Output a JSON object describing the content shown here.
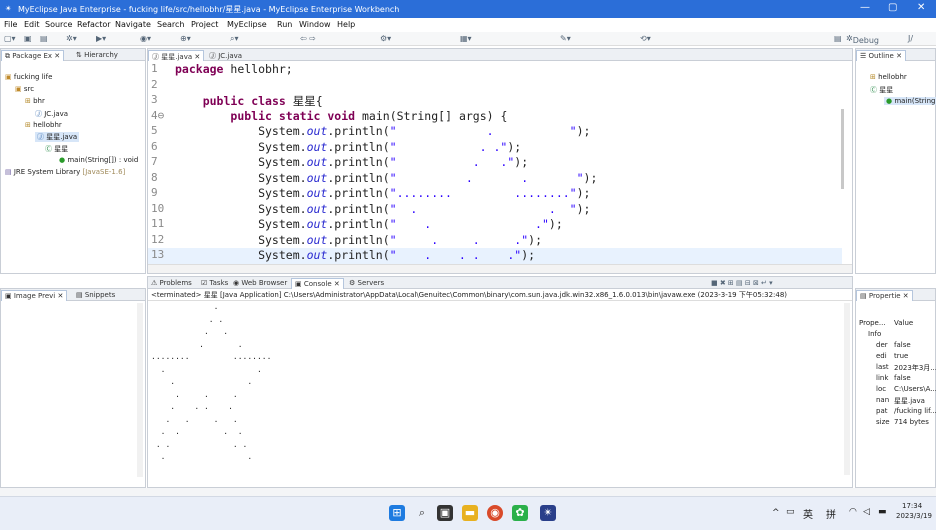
{
  "window": {
    "title": "MyEclipse Java Enterprise - fucking life/src/hellobhr/星星.java - MyEclipse Enterprise Workbench",
    "minimize": "—",
    "maximize": "▢",
    "close": "✕"
  },
  "menu": [
    "File",
    "Edit",
    "Source",
    "Refactor",
    "Navigate",
    "Search",
    "Project",
    "MyEclipse",
    "Run",
    "Window",
    "Help"
  ],
  "perspectives": {
    "debug": "Debug",
    "other": "J/"
  },
  "package_explorer": {
    "tabs": [
      "Package Ex",
      "Hierarchy"
    ],
    "tree": [
      {
        "label": "fucking life"
      },
      {
        "label": "src"
      },
      {
        "label": "bhr"
      },
      {
        "label": "JC.java"
      },
      {
        "label": "hellobhr"
      },
      {
        "label": "星星.java"
      },
      {
        "label": "星星"
      },
      {
        "label": "main(String[]) : void"
      },
      {
        "label": "JRE System Library",
        "suffix": "[JavaSE-1.6]"
      }
    ]
  },
  "image_panel": {
    "tabs": [
      "Image Previ",
      "Snippets"
    ]
  },
  "editor": {
    "tabs": [
      "星星.java",
      "JC.java"
    ],
    "lines": [
      {
        "n": "1",
        "html": "package hellobhr;"
      },
      {
        "n": "2",
        "html": ""
      },
      {
        "n": "3",
        "html": "    public class 星星{"
      },
      {
        "n": "4⊖",
        "html": "        public static void main(String[] args) {"
      },
      {
        "n": "5",
        "pre": "            System.",
        "out": "out",
        "post": ".println(\"             .           \");"
      },
      {
        "n": "6",
        "pre": "            System.",
        "out": "out",
        "post": ".println(\"            . .\");"
      },
      {
        "n": "7",
        "pre": "            System.",
        "out": "out",
        "post": ".println(\"           .   .\");"
      },
      {
        "n": "8",
        "pre": "            System.",
        "out": "out",
        "post": ".println(\"          .       .       \");"
      },
      {
        "n": "9",
        "pre": "            System.",
        "out": "out",
        "post": ".println(\"........         ........\");"
      },
      {
        "n": "10",
        "pre": "            System.",
        "out": "out",
        "post": ".println(\"  .                   .  \");"
      },
      {
        "n": "11",
        "pre": "            System.",
        "out": "out",
        "post": ".println(\"    .               .\");"
      },
      {
        "n": "12",
        "pre": "            System.",
        "out": "out",
        "post": ".println(\"     .     .     .\");"
      },
      {
        "n": "13",
        "pre": "            System.",
        "out": "out",
        "post": ".println(\"    .    . .    .\");"
      }
    ]
  },
  "console": {
    "tabs": [
      "Problems",
      "Tasks",
      "Web Browser",
      "Console",
      "Servers"
    ],
    "status": "<terminated> 星星 [Java Application] C:\\Users\\Administrator\\AppData\\Local\\Genuitec\\Common\\binary\\com.sun.java.jdk.win32.x86_1.6.0.013\\bin\\javaw.exe (2023-3-19 下午05:32:48)",
    "output": [
      "             .",
      "            . .",
      "           .   .",
      "          .       .",
      "........         ........",
      "  .                   .",
      "    .               .",
      "     .     .     .",
      "    .    . .    .",
      "   .   .     .   .",
      "  .  .         .  .",
      " . .             . .",
      "  .                 ."
    ]
  },
  "outline": {
    "tabs": [
      "Outline"
    ],
    "items": [
      "hellobhr",
      "星星",
      "main(String"
    ]
  },
  "properties": {
    "tabs": [
      "Propertie"
    ],
    "headers": [
      "Prope...",
      "Value"
    ],
    "group": "Info",
    "rows": [
      {
        "k": "der",
        "v": "false"
      },
      {
        "k": "edi",
        "v": "true"
      },
      {
        "k": "last",
        "v": "2023年3月..."
      },
      {
        "k": "link",
        "v": "false"
      },
      {
        "k": "loc",
        "v": "C:\\Users\\A..."
      },
      {
        "k": "nan",
        "v": "星星.java"
      },
      {
        "k": "pat",
        "v": "/fucking lif..."
      },
      {
        "k": "size",
        "v": "714  bytes"
      }
    ]
  },
  "taskbar": {
    "ime": "英",
    "ime2": "拼",
    "time": "17:34",
    "date": "2023/3/19"
  }
}
